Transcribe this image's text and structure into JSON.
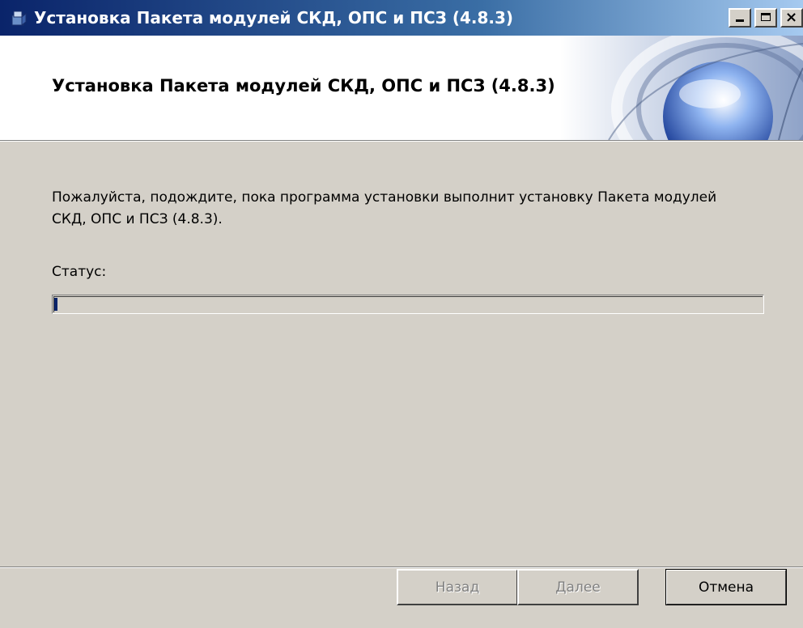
{
  "window": {
    "title": "Установка Пакета модулей СКД, ОПС и ПСЗ (4.8.3)",
    "icon": "installer-icon"
  },
  "banner": {
    "title": "Установка Пакета модулей СКД, ОПС и ПСЗ (4.8.3)"
  },
  "content": {
    "message": "Пожалуйста, подождите, пока программа установки выполнит установку Пакета модулей СКД, ОПС и ПСЗ (4.8.3).",
    "status_label": "Статус:",
    "progress_fraction": 0.005
  },
  "buttons": {
    "back_label": "Назад",
    "next_label": "Далее",
    "cancel_label": "Отмена"
  },
  "colors": {
    "titlebar": "#0a246a",
    "dialog_bg": "#d4d0c8",
    "progress_fill": "#0a246a"
  }
}
